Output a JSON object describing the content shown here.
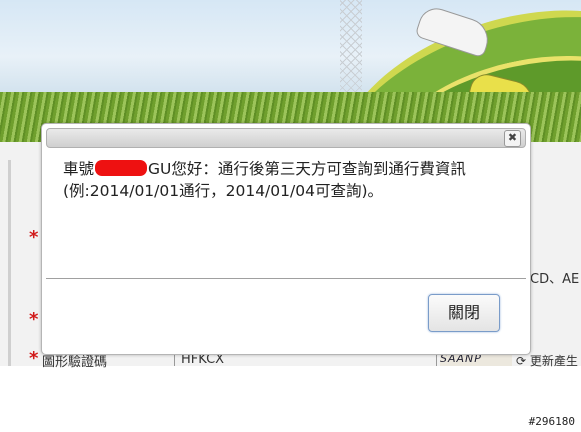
{
  "background_form": {
    "fields": [
      {
        "label": "",
        "value": ""
      },
      {
        "label": "",
        "value": ""
      },
      {
        "label": "圖形驗證碼",
        "value": "HFKCX"
      }
    ],
    "side_hint": "CD、AE",
    "captcha_text": "SAANP",
    "refresh_label": "更新產生"
  },
  "dialog": {
    "message_prefix": "車號",
    "message_suffix": "GU您好：通行後第三天方可查詢到通行費資訊(例:2014/01/01通行，2014/01/04可查詢)。",
    "close_button_label": "關閉",
    "close_x_label": "✖"
  },
  "watermark": "#296180",
  "colors": {
    "required": "#d11a1a",
    "redaction": "#ee1111",
    "button_border": "#7a9cc9"
  }
}
